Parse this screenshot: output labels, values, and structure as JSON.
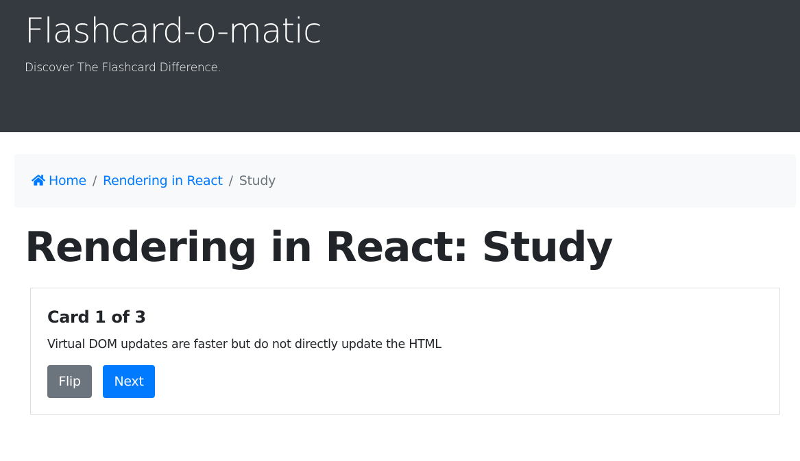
{
  "header": {
    "title": "Flashcard-o-matic",
    "tagline": "Discover The Flashcard Difference."
  },
  "breadcrumb": {
    "home_icon": "home-icon",
    "home_label": "Home",
    "deck_label": "Rendering in React",
    "separator": "/",
    "current_label": "Study"
  },
  "page": {
    "title": "Rendering in React: Study"
  },
  "card": {
    "title": "Card 1 of 3",
    "text": "Virtual DOM updates are faster but do not directly update the HTML",
    "flip_label": "Flip",
    "next_label": "Next"
  },
  "colors": {
    "header_bg": "#343a40",
    "link": "#007bff",
    "secondary": "#6c757d",
    "breadcrumb_bg": "#f8f9fa"
  }
}
